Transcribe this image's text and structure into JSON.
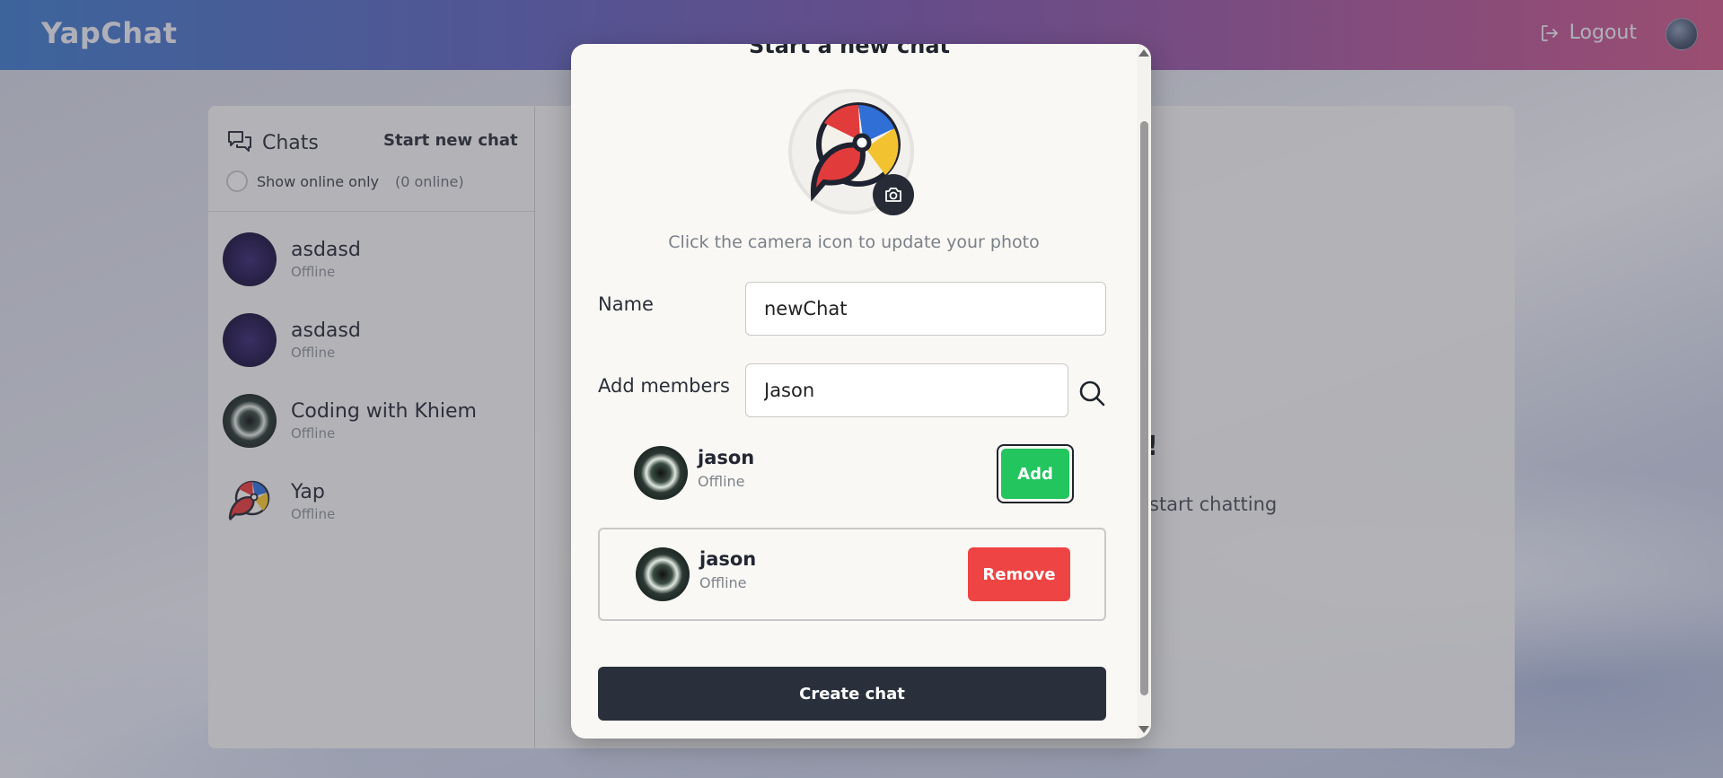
{
  "app": {
    "logo": "YapChat"
  },
  "nav": {
    "logout_label": "Logout"
  },
  "sidebar": {
    "title": "Chats",
    "start_new_chat": "Start new chat",
    "show_online_label": "Show online only",
    "online_count": "(0 online)",
    "chats": [
      {
        "name": "asdasd",
        "status": "Offline",
        "avatar": "purple-avatar"
      },
      {
        "name": "asdasd",
        "status": "Offline",
        "avatar": "purple-avatar"
      },
      {
        "name": "Coding with Khiem",
        "status": "Offline",
        "avatar": "glow-avatar"
      },
      {
        "name": "Yap",
        "status": "Offline",
        "avatar": "beachball-avatar"
      }
    ]
  },
  "background": {
    "welcome_title": "t!",
    "welcome_sub": "start chatting"
  },
  "modal": {
    "title": "Start a new chat",
    "photo_hint": "Click the camera icon to update your photo",
    "name_label": "Name",
    "name_value": "newChat",
    "members_label": "Add members",
    "members_value": "Jason",
    "search_result": {
      "name": "jason",
      "status": "Offline",
      "add_label": "Add"
    },
    "selected_member": {
      "name": "jason",
      "status": "Offline",
      "remove_label": "Remove"
    },
    "create_label": "Create chat"
  },
  "colors": {
    "add": "#22c55e",
    "remove": "#ef4444",
    "primary_dark": "#2a303b"
  }
}
